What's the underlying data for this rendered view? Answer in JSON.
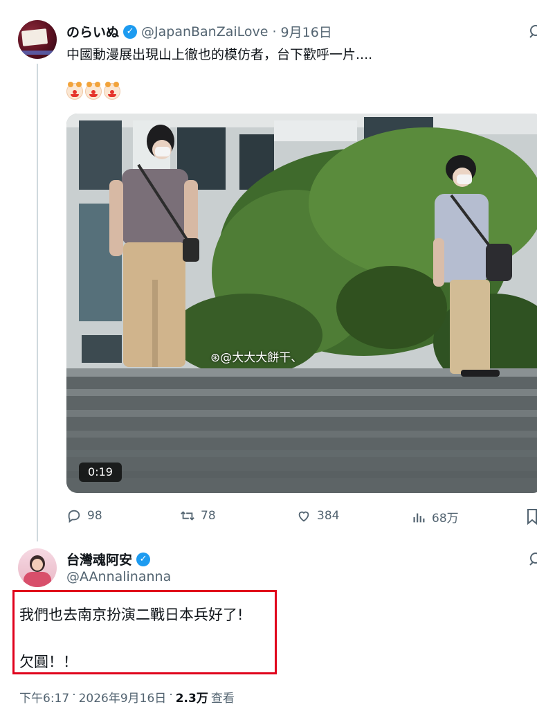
{
  "tweet": {
    "display_name": "のらいぬ",
    "handle": "@JapanBanZaiLove",
    "separator": "·",
    "date": "9月16日",
    "text": "中國動漫展出現山上徹也的模仿者，台下歡呼一片....",
    "emoji_icons": [
      "clown-face-icon",
      "clown-face-icon",
      "clown-face-icon"
    ],
    "media": {
      "duration": "0:19",
      "watermark": "@大大大餅干、"
    },
    "actions": {
      "replies": "98",
      "retweets": "78",
      "likes": "384",
      "views": "68万"
    }
  },
  "reply": {
    "display_name": "台灣魂阿安",
    "handle": "@AAnnalinanna",
    "line1": "我們也去南京扮演二戰日本兵好了!",
    "line2": "欠圓！！",
    "time": "下午6:17",
    "separator": "·",
    "date": "2026年9月16日",
    "views": "2.3万",
    "views_label": "查看"
  },
  "colors": {
    "verified": "#1d9bf0",
    "secondary_text": "#536471",
    "highlight_border": "#e0001b"
  }
}
